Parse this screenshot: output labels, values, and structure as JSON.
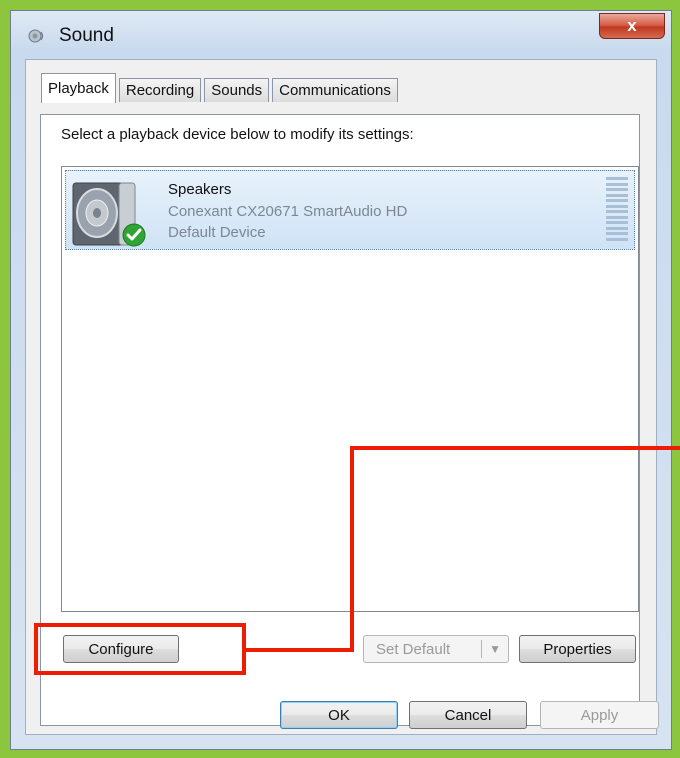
{
  "window": {
    "title": "Sound",
    "close_glyph": "x",
    "icon": "speaker-icon"
  },
  "tabs": [
    {
      "label": "Playback",
      "active": true
    },
    {
      "label": "Recording",
      "active": false
    },
    {
      "label": "Sounds",
      "active": false
    },
    {
      "label": "Communications",
      "active": false
    }
  ],
  "playback": {
    "instruction": "Select a playback device below to modify its settings:",
    "devices": [
      {
        "name": "Speakers",
        "driver": "Conexant CX20671 SmartAudio HD",
        "status": "Default Device",
        "icon": "speaker-icon",
        "badge": "green-check-icon"
      }
    ],
    "buttons": {
      "configure": "Configure",
      "set_default": "Set Default",
      "properties": "Properties"
    }
  },
  "footer": {
    "ok": "OK",
    "cancel": "Cancel",
    "apply": "Apply"
  },
  "colors": {
    "highlight": "#ee1c00",
    "frame": "#8cc63f",
    "selection": "#cfe3f6"
  }
}
